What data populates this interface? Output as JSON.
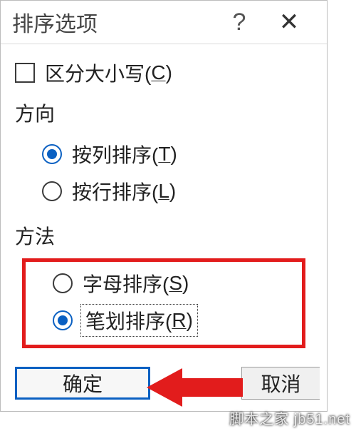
{
  "title": "排序选项",
  "caseSensitive": {
    "label": "区分大小写(",
    "mnemonic": "C",
    "label_end": ")",
    "checked": false
  },
  "direction": {
    "title": "方向",
    "options": [
      {
        "label": "按列排序(",
        "mnemonic": "T",
        "label_end": ")",
        "selected": true
      },
      {
        "label": "按行排序(",
        "mnemonic": "L",
        "label_end": ")",
        "selected": false
      }
    ]
  },
  "method": {
    "title": "方法",
    "options": [
      {
        "label": "字母排序(",
        "mnemonic": "S",
        "label_end": ")",
        "selected": false
      },
      {
        "label": "笔划排序(",
        "mnemonic": "R",
        "label_end": ")",
        "selected": true,
        "focused": true
      }
    ]
  },
  "buttons": {
    "ok": "确定",
    "cancel": "取消"
  },
  "watermark": "脚本之家 jb51.net"
}
